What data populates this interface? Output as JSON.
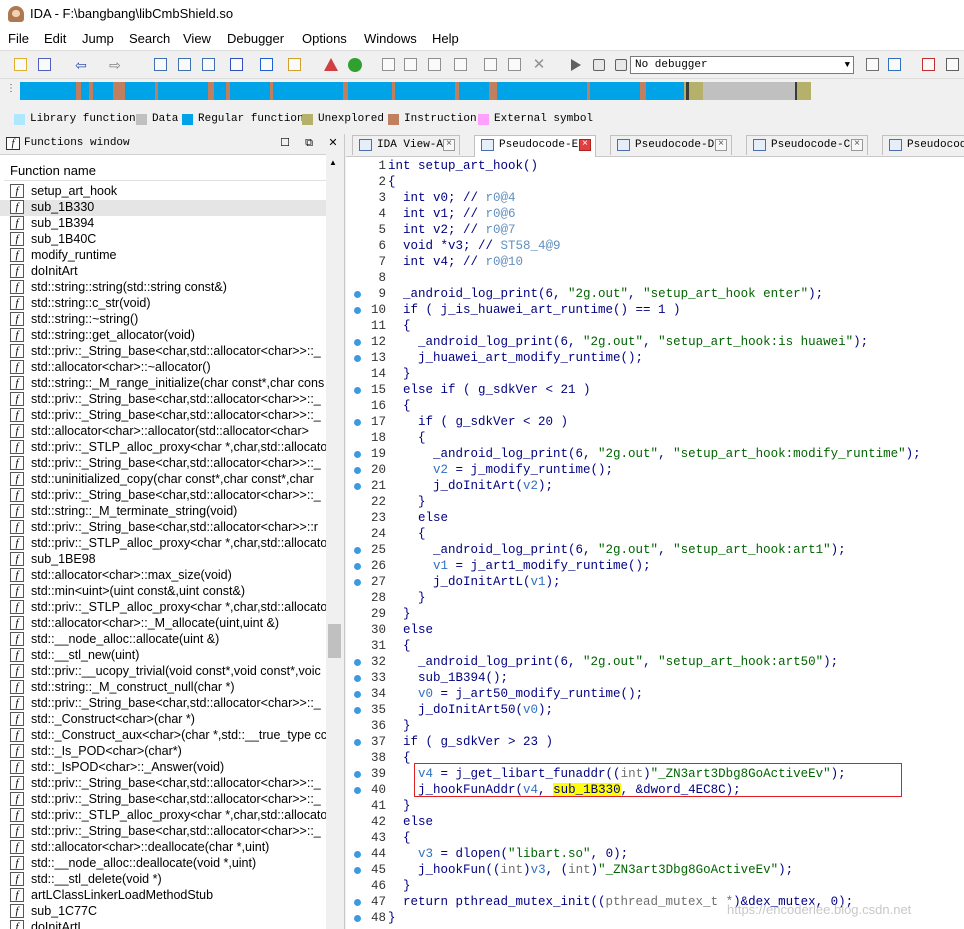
{
  "window": {
    "title": "IDA - F:\\bangbang\\libCmbShield.so"
  },
  "menu": [
    "File",
    "Edit",
    "Jump",
    "Search",
    "View",
    "Debugger",
    "Options",
    "Windows",
    "Help"
  ],
  "toolbar": {
    "debugger": "No debugger"
  },
  "legend": [
    {
      "label": "Library function",
      "color": "#aee8ff"
    },
    {
      "label": "Data",
      "color": "#c0c0c0"
    },
    {
      "label": "Regular function",
      "color": "#00a2e8"
    },
    {
      "label": "Unexplored",
      "color": "#b5b06a"
    },
    {
      "label": "Instruction",
      "color": "#c08060"
    },
    {
      "label": "External symbol",
      "color": "#ffa0ff"
    }
  ],
  "functions_window": {
    "title": "Functions window",
    "column": "Function name",
    "selected_index": 1,
    "items": [
      "setup_art_hook",
      "sub_1B330",
      "sub_1B394",
      "sub_1B40C",
      "modify_runtime",
      "doInitArt",
      "std::string::string(std::string const&)",
      "std::string::c_str(void)",
      "std::string::~string()",
      "std::string::get_allocator(void)",
      "std::priv::_String_base<char,std::allocator<char>>::_",
      "std::allocator<char>::~allocator()",
      "std::string::_M_range_initialize(char const*,char cons",
      "std::priv::_String_base<char,std::allocator<char>>::_",
      "std::priv::_String_base<char,std::allocator<char>>::_",
      "std::allocator<char>::allocator(std::allocator<char>",
      "std::priv::_STLP_alloc_proxy<char *,char,std::allocato",
      "std::priv::_String_base<char,std::allocator<char>>::_",
      "std::uninitialized_copy(char const*,char const*,char",
      "std::priv::_String_base<char,std::allocator<char>>::_",
      "std::string::_M_terminate_string(void)",
      "std::priv::_String_base<char,std::allocator<char>>::r",
      "std::priv::_STLP_alloc_proxy<char *,char,std::allocato",
      "sub_1BE98",
      "std::allocator<char>::max_size(void)",
      "std::min<uint>(uint const&,uint const&)",
      "std::priv::_STLP_alloc_proxy<char *,char,std::allocato",
      "std::allocator<char>::_M_allocate(uint,uint &)",
      "std::__node_alloc::allocate(uint &)",
      "std::__stl_new(uint)",
      "std::priv::__ucopy_trivial(void const*,void const*,voic",
      "std::string::_M_construct_null(char *)",
      "std::priv::_String_base<char,std::allocator<char>>::_",
      "std::_Construct<char>(char *)",
      "std::_Construct_aux<char>(char *,std::__true_type cc",
      "std::_Is_POD<char>(char*)",
      "std::_IsPOD<char>::_Answer(void)",
      "std::priv::_String_base<char,std::allocator<char>>::_",
      "std::priv::_String_base<char,std::allocator<char>>::_",
      "std::priv::_STLP_alloc_proxy<char *,char,std::allocato",
      "std::priv::_String_base<char,std::allocator<char>>::_",
      "std::allocator<char>::deallocate(char *,uint)",
      "std::__node_alloc::deallocate(void *,uint)",
      "std::__stl_delete(void *)",
      "artLClassLinkerLoadMethodStub",
      "sub_1C77C",
      "doInitArtL"
    ]
  },
  "tabs": [
    {
      "label": "IDA View-A",
      "active": false
    },
    {
      "label": "Pseudocode-E",
      "active": true
    },
    {
      "label": "Pseudocode-D",
      "active": false
    },
    {
      "label": "Pseudocode-C",
      "active": false
    },
    {
      "label": "Pseudocod",
      "active": false
    }
  ],
  "code": [
    {
      "n": "1",
      "dot": false,
      "html": "int setup_art_hook()"
    },
    {
      "n": "2",
      "dot": false,
      "html": "{"
    },
    {
      "n": "3",
      "dot": false,
      "html": "  int v0; // <c>r0@4</c>"
    },
    {
      "n": "4",
      "dot": false,
      "html": "  int v1; // <c>r0@6</c>"
    },
    {
      "n": "5",
      "dot": false,
      "html": "  int v2; // <c>r0@7</c>"
    },
    {
      "n": "6",
      "dot": false,
      "html": "  void *v3; // <c>ST58_4@9</c>"
    },
    {
      "n": "7",
      "dot": false,
      "html": "  int v4; // <c>r0@10</c>"
    },
    {
      "n": "8",
      "dot": false,
      "html": ""
    },
    {
      "n": "9",
      "dot": true,
      "html": "  _android_log_print(6, <s>\"2g.out\"</s>, <s>\"setup_art_hook enter\"</s>);"
    },
    {
      "n": "10",
      "dot": true,
      "html": "  if ( j_is_huawei_art_runtime() == 1 )"
    },
    {
      "n": "11",
      "dot": false,
      "html": "  {"
    },
    {
      "n": "12",
      "dot": true,
      "html": "    _android_log_print(6, <s>\"2g.out\"</s>, <s>\"setup_art_hook:is huawei\"</s>);"
    },
    {
      "n": "13",
      "dot": true,
      "html": "    j_huawei_art_modify_runtime();"
    },
    {
      "n": "14",
      "dot": false,
      "html": "  }"
    },
    {
      "n": "15",
      "dot": true,
      "html": "  else if ( g_sdkVer &lt; 21 )"
    },
    {
      "n": "16",
      "dot": false,
      "html": "  {"
    },
    {
      "n": "17",
      "dot": true,
      "html": "    if ( g_sdkVer &lt; 20 )"
    },
    {
      "n": "18",
      "dot": false,
      "html": "    {"
    },
    {
      "n": "19",
      "dot": true,
      "html": "      _android_log_print(6, <s>\"2g.out\"</s>, <s>\"setup_art_hook:modify_runtime\"</s>);"
    },
    {
      "n": "20",
      "dot": true,
      "html": "      <v>v2</v> = j_modify_runtime();"
    },
    {
      "n": "21",
      "dot": true,
      "html": "      j_doInitArt(<v>v2</v>);"
    },
    {
      "n": "22",
      "dot": false,
      "html": "    }"
    },
    {
      "n": "23",
      "dot": false,
      "html": "    else"
    },
    {
      "n": "24",
      "dot": false,
      "html": "    {"
    },
    {
      "n": "25",
      "dot": true,
      "html": "      _android_log_print(6, <s>\"2g.out\"</s>, <s>\"setup_art_hook:art1\"</s>);"
    },
    {
      "n": "26",
      "dot": true,
      "html": "      <v>v1</v> = j_art1_modify_runtime();"
    },
    {
      "n": "27",
      "dot": true,
      "html": "      j_doInitArtL(<v>v1</v>);"
    },
    {
      "n": "28",
      "dot": false,
      "html": "    }"
    },
    {
      "n": "29",
      "dot": false,
      "html": "  }"
    },
    {
      "n": "30",
      "dot": false,
      "html": "  else"
    },
    {
      "n": "31",
      "dot": false,
      "html": "  {"
    },
    {
      "n": "32",
      "dot": true,
      "html": "    _android_log_print(6, <s>\"2g.out\"</s>, <s>\"setup_art_hook:art50\"</s>);"
    },
    {
      "n": "33",
      "dot": true,
      "html": "    sub_1B394();"
    },
    {
      "n": "34",
      "dot": true,
      "html": "    <v>v0</v> = j_art50_modify_runtime();"
    },
    {
      "n": "35",
      "dot": true,
      "html": "    j_doInitArt50(<v>v0</v>);"
    },
    {
      "n": "36",
      "dot": false,
      "html": "  }"
    },
    {
      "n": "37",
      "dot": true,
      "html": "  if ( g_sdkVer &gt; 23 )"
    },
    {
      "n": "38",
      "dot": false,
      "html": "  {"
    },
    {
      "n": "39",
      "dot": true,
      "html": "    <v>v4</v> = j_get_libart_funaddr((<t>int</t>)<s>\"_ZN3art3Dbg8GoActiveEv\"</s>);"
    },
    {
      "n": "40",
      "dot": true,
      "html": "    j_hookFunAddr(<v>v4</v>, <h>sub_1B330</h>, &amp;dword_4EC8C);"
    },
    {
      "n": "41",
      "dot": false,
      "html": "  }"
    },
    {
      "n": "42",
      "dot": false,
      "html": "  else"
    },
    {
      "n": "43",
      "dot": false,
      "html": "  {"
    },
    {
      "n": "44",
      "dot": true,
      "html": "    <v>v3</v> = dlopen(<s>\"libart.so\"</s>, 0);"
    },
    {
      "n": "45",
      "dot": true,
      "html": "    j_hookFun((<t>int</t>)<v>v3</v>, (<t>int</t>)<s>\"_ZN3art3Dbg8GoActiveEv\"</s>);"
    },
    {
      "n": "46",
      "dot": false,
      "html": "  }"
    },
    {
      "n": "47",
      "dot": true,
      "html": "  return pthread_mutex_init((<t>pthread_mutex_t *</t>)&amp;dex_mutex, 0);"
    },
    {
      "n": "48",
      "dot": true,
      "html": "}"
    }
  ],
  "watermark": "https://encoderlee.blog.csdn.net"
}
